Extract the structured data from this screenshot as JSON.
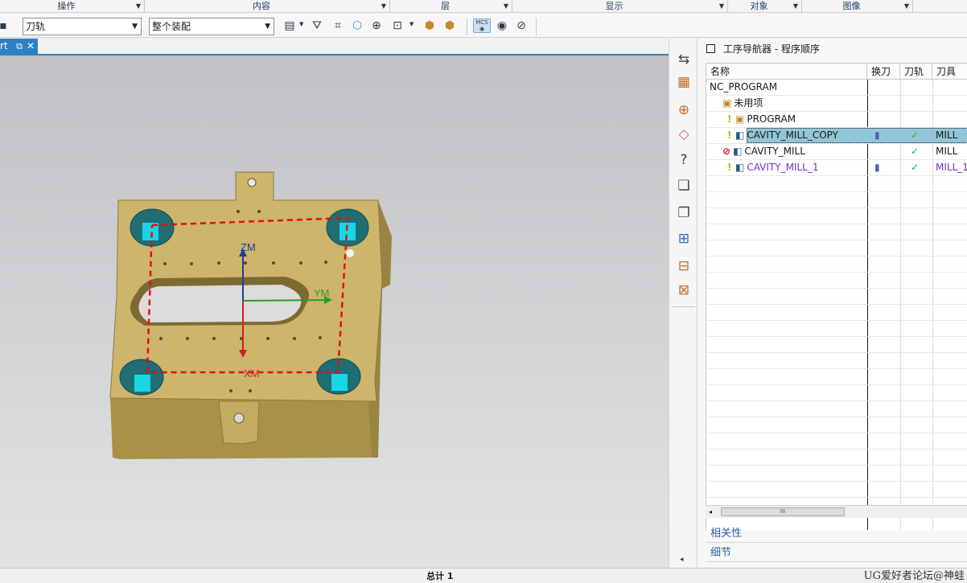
{
  "menu_groups": [
    {
      "label": "操作"
    },
    {
      "label": "内容"
    },
    {
      "label": "层"
    },
    {
      "label": "显示"
    },
    {
      "label": "对象"
    },
    {
      "label": "图像"
    }
  ],
  "toolbar": {
    "filter_value": "刀轨",
    "scope_value": "整个装配",
    "mcs_label": "MCS"
  },
  "viewport": {
    "tab_label": "rt",
    "axes": {
      "zm": "ZM",
      "ym": "YM",
      "xm": "XM"
    }
  },
  "navigator": {
    "title": "工序导航器 - 程序顺序",
    "columns": {
      "name": "名称",
      "tool_change": "换刀",
      "toolpath": "刀轨",
      "tool": "刀具"
    },
    "rows": [
      {
        "name": "NC_PROGRAM",
        "toolpath": "",
        "tool": ""
      },
      {
        "name": "未用项",
        "toolpath": "",
        "tool": ""
      },
      {
        "name": "PROGRAM",
        "toolpath": "",
        "tool": ""
      },
      {
        "name": "CAVITY_MILL_COPY",
        "toolpath": "✓",
        "tool": "MILL"
      },
      {
        "name": "CAVITY_MILL",
        "toolpath": "✓",
        "tool": "MILL"
      },
      {
        "name": "CAVITY_MILL_1",
        "toolpath": "✓",
        "tool": "MILL_1"
      }
    ],
    "scroll_thumb": "III",
    "sections": {
      "dependencies": "相关性",
      "details": "细节"
    }
  },
  "status": {
    "total": "总计 1",
    "brand": "UG爱好者论坛@神蛙"
  },
  "colors": {
    "accent": "#2f7fc4",
    "part": "#c9b36a",
    "selected_row": "#92c6d6",
    "toolpath_dash": "#e01010"
  }
}
